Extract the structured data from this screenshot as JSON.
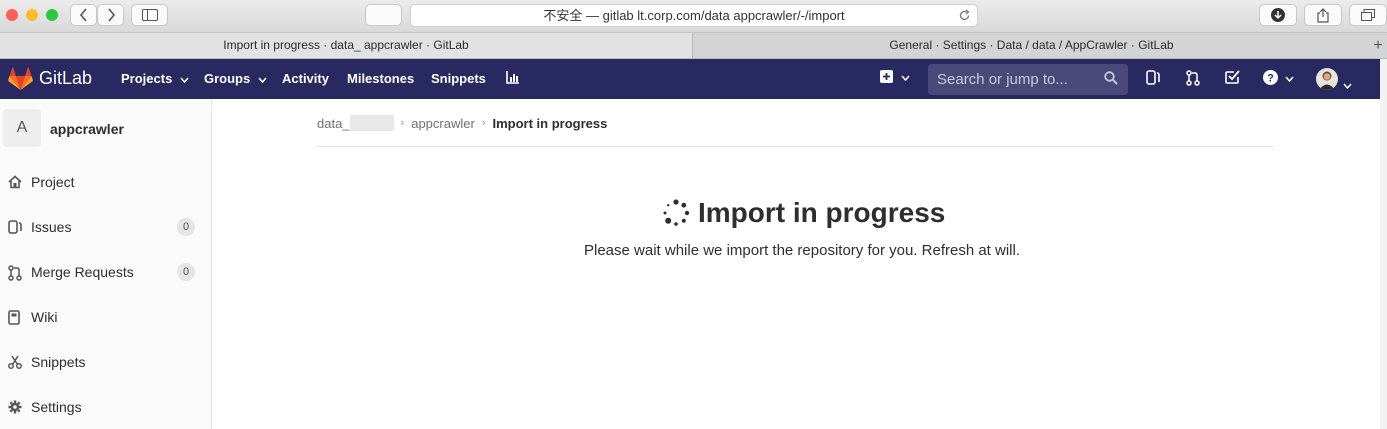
{
  "browser": {
    "url": "不安全 — gitlab        lt.corp.com/data         appcrawler/-/import",
    "tabs": [
      {
        "title": "Import in progress · data_        appcrawler · GitLab"
      },
      {
        "title": "General · Settings · Data / data          / AppCrawler · GitLab"
      }
    ]
  },
  "navbar": {
    "brand": "GitLab",
    "items": [
      "Projects",
      "Groups",
      "Activity",
      "Milestones",
      "Snippets"
    ],
    "search_placeholder": "Search or jump to..."
  },
  "sidebar": {
    "project_initial": "A",
    "project_name": "appcrawler",
    "items": [
      {
        "label": "Project",
        "icon": "home-icon"
      },
      {
        "label": "Issues",
        "icon": "issues-icon",
        "count": "0"
      },
      {
        "label": "Merge Requests",
        "icon": "merge-request-icon",
        "count": "0"
      },
      {
        "label": "Wiki",
        "icon": "book-icon"
      },
      {
        "label": "Snippets",
        "icon": "scissors-icon"
      },
      {
        "label": "Settings",
        "icon": "gear-icon"
      }
    ]
  },
  "breadcrumb": {
    "group": "data_",
    "project": "appcrawler",
    "current": "Import in progress"
  },
  "main": {
    "title": "Import in progress",
    "subtitle": "Please wait while we import the repository for you. Refresh at will."
  },
  "colors": {
    "navbar": "#292961",
    "search_bg": "#4a4a7a",
    "gitlab_orange": "#e24329"
  }
}
